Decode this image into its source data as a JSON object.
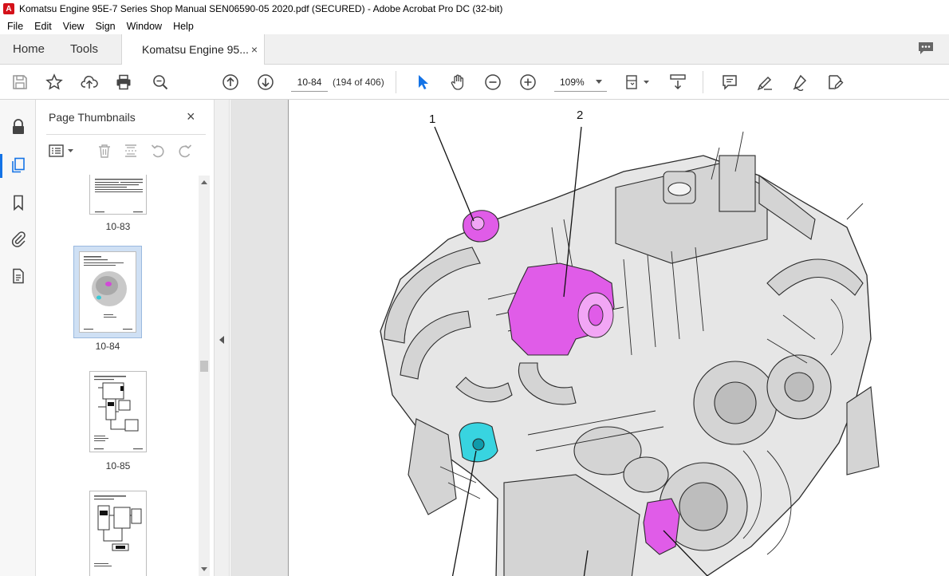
{
  "window": {
    "title": "Komatsu Engine 95E-7 Series Shop Manual SEN06590-05 2020.pdf (SECURED) - Adobe Acrobat Pro DC (32-bit)"
  },
  "menu": [
    "File",
    "Edit",
    "View",
    "Sign",
    "Window",
    "Help"
  ],
  "tabs": {
    "home": "Home",
    "tools": "Tools",
    "document": "Komatsu Engine 95...",
    "close": "×"
  },
  "toolbar": {
    "page_value": "10-84",
    "page_count": "(194 of 406)",
    "zoom_value": "109%"
  },
  "thumbnails": {
    "title": "Page Thumbnails",
    "close": "×",
    "pages": [
      {
        "label": "10-83"
      },
      {
        "label": "10-84",
        "selected": true
      },
      {
        "label": "10-85"
      },
      {
        "label": ""
      }
    ]
  },
  "document": {
    "callouts": [
      "1",
      "2"
    ]
  },
  "colors": {
    "accent": "#1473e6",
    "highlight_magenta": "#e05ce8",
    "highlight_cyan": "#38d4e0"
  }
}
